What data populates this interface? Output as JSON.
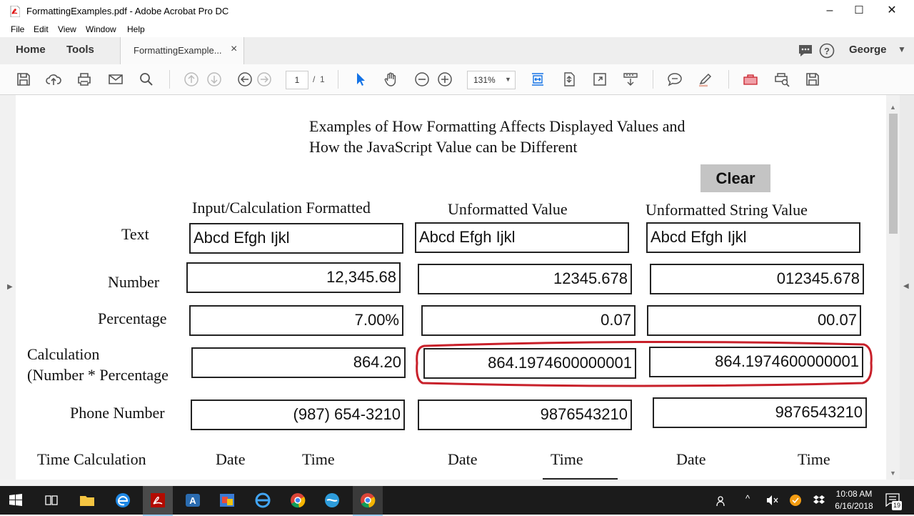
{
  "window": {
    "title": "FormattingExamples.pdf - Adobe Acrobat Pro DC",
    "minimize": "–",
    "maximize": "☐",
    "close": "✕"
  },
  "menu": [
    "File",
    "Edit",
    "View",
    "Window",
    "Help"
  ],
  "nav": {
    "home": "Home",
    "tools": "Tools",
    "tab_label": "FormattingExample...",
    "tab_close": "×",
    "user": "George"
  },
  "toolbar": {
    "page_current": "1",
    "page_sep": "/",
    "page_total": "1",
    "zoom": "131%"
  },
  "document": {
    "heading_line1": "Examples of How Formatting Affects Displayed Values and",
    "heading_line2": "How the JavaScript Value can be Different",
    "clear_button": "Clear",
    "columns": [
      "Input/Calculation Formatted",
      "Unformatted Value",
      "Unformatted String Value"
    ],
    "rows": [
      {
        "label": "Text",
        "values": [
          "Abcd Efgh Ijkl",
          "Abcd Efgh Ijkl",
          "Abcd Efgh Ijkl"
        ]
      },
      {
        "label": "Number",
        "values": [
          "12,345.68",
          "12345.678",
          "012345.678"
        ]
      },
      {
        "label": "Percentage",
        "values": [
          "7.00%",
          "0.07",
          "00.07"
        ]
      },
      {
        "label": "Calculation",
        "label2": "(Number * Percentage",
        "values": [
          "864.20",
          "864.1974600000001",
          "864.1974600000001"
        ]
      },
      {
        "label": "Phone Number",
        "values": [
          "(987) 654-3210",
          "9876543210",
          "9876543210"
        ]
      }
    ],
    "time_row": {
      "label": "Time Calculation",
      "sub": [
        "Date",
        "Time",
        "Date",
        "Time",
        "Date",
        "Time"
      ]
    }
  },
  "taskbar": {
    "time": "10:08 AM",
    "date": "6/16/2018",
    "notifications": "19"
  },
  "colors": {
    "highlight_ring": "#c8202a",
    "clear_button_bg": "#c4c4c4",
    "taskbar_bg": "#1b1b1b",
    "toolbar_accent": "#1473e6"
  }
}
